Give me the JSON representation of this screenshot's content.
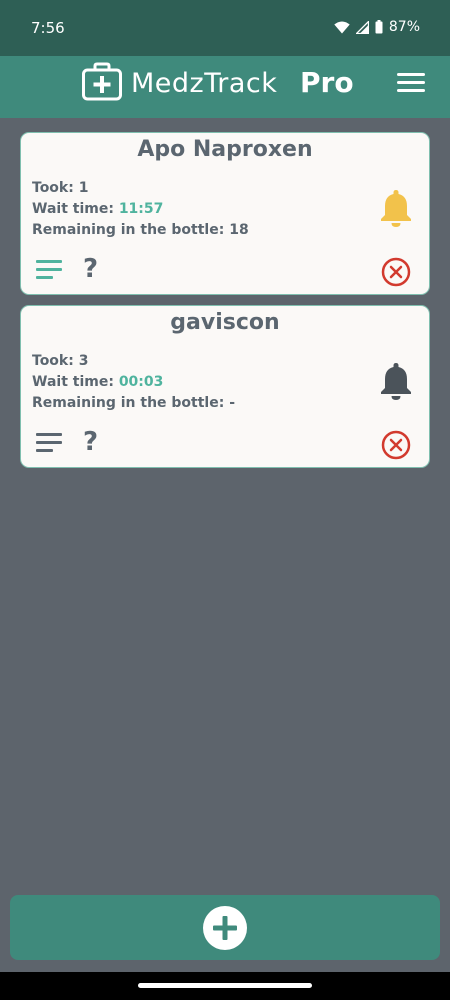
{
  "status": {
    "time": "7:56",
    "battery": "87%"
  },
  "app": {
    "title": "MedzTrack",
    "title_suffix": "Pro"
  },
  "meds": [
    {
      "name": "Apo Naproxen",
      "took_label": "Took:",
      "took_value": "1",
      "wait_label": "Wait time:",
      "wait_value": "11:57",
      "remaining_label": "Remaining in the bottle:",
      "remaining_value": "18",
      "bell_color": "#f2c24b",
      "detail_color": "#4fb39e",
      "help_text": "?"
    },
    {
      "name": "gaviscon",
      "took_label": "Took:",
      "took_value": "3",
      "wait_label": "Wait time:",
      "wait_value": "00:03",
      "remaining_label": "Remaining in the bottle:",
      "remaining_value": "-",
      "bell_color": "#4b535a",
      "detail_color": "#5b6670",
      "help_text": "?"
    }
  ],
  "colors": {
    "accent": "#3f8a7c",
    "status_bar": "#2e5f55",
    "background": "#5d646c",
    "delete": "#d23a2e"
  }
}
